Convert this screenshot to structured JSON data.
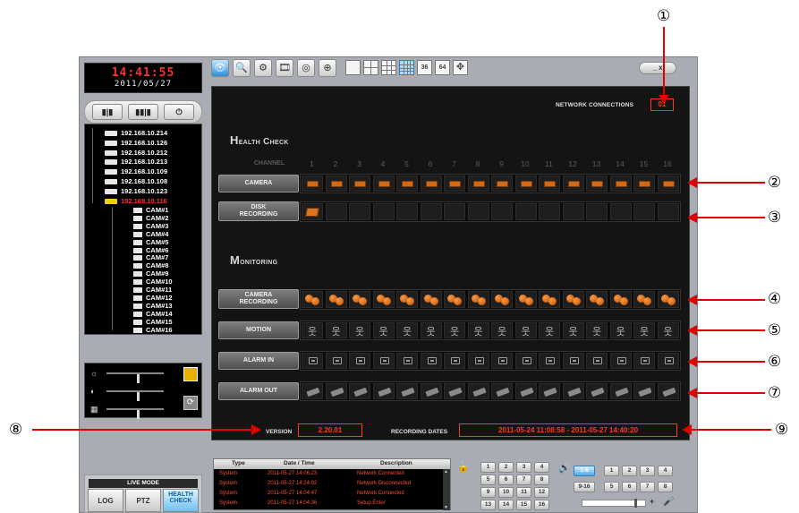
{
  "clock": {
    "time": "14:41:55",
    "date": "2011/05/27"
  },
  "split_buttons": [
    "▮|▮",
    "▮▮|▮",
    "⏻"
  ],
  "tree": {
    "devices": [
      "192.168.10.214",
      "192.168.10.126",
      "192.168.10.212",
      "192.168.10.213",
      "192.168.10.109",
      "192.168.10.108",
      "192.168.10.123",
      "192.168.10.116"
    ],
    "cameras": [
      "CAM#1",
      "CAM#2",
      "CAM#3",
      "CAM#4",
      "CAM#5",
      "CAM#6",
      "CAM#7",
      "CAM#8",
      "CAM#9",
      "CAM#10",
      "CAM#11",
      "CAM#12",
      "CAM#13",
      "CAM#14",
      "CAM#15",
      "CAM#16"
    ]
  },
  "adjust": {
    "icons": [
      "☼",
      "◐",
      "▦"
    ],
    "reset_icon": "⟳"
  },
  "mode": {
    "label": "LIVE MODE",
    "log": "LOG",
    "ptz": "PTZ",
    "health": "HEALTH CHECK"
  },
  "toolbar": {
    "tools": [
      "👁",
      "🔍",
      "⚙",
      "🎞",
      "◎",
      "⊕"
    ],
    "layouts": [
      "1",
      "4",
      "9",
      "16",
      "36",
      "64"
    ],
    "win_ctrl": "_  x"
  },
  "health": {
    "network_label": "NETWORK CONNECTIONS",
    "network_value": "01",
    "health_title": "Health Check",
    "monitoring_title": "Monitoring",
    "channel_label": "CHANNEL",
    "channels": [
      "1",
      "2",
      "3",
      "4",
      "5",
      "6",
      "7",
      "8",
      "9",
      "10",
      "11",
      "12",
      "13",
      "14",
      "15",
      "16"
    ],
    "row_camera": "CAMERA",
    "row_disk_1": "DISK",
    "row_disk_2": "RECORDING",
    "row_camrec_1": "CAMERA",
    "row_camrec_2": "RECORDING",
    "row_motion": "MOTION",
    "row_alarm_in": "ALARM IN",
    "row_alarm_out": "ALARM OUT",
    "motion_glyph": "웃",
    "version_label": "VERSION",
    "version_value": "2.20.01",
    "recdates_label": "RECORDING DATES",
    "recdates_value": "2011-05-24 11:08:58  -  2011-05-27 14:40:20"
  },
  "log": {
    "headers": {
      "type": "Type",
      "datetime": "Date / Time",
      "description": "Description"
    },
    "rows": [
      {
        "type": "System",
        "datetime": "2011-05-27 14:06:23",
        "description": "Network Connected"
      },
      {
        "type": "System",
        "datetime": "2011-05-27 14:24:02",
        "description": "Network Disconnected"
      },
      {
        "type": "System",
        "datetime": "2011-05-27 14:04:47",
        "description": "Network Connected"
      },
      {
        "type": "System",
        "datetime": "2011-05-27 14:04:36",
        "description": "Setup Enter"
      }
    ]
  },
  "channel_grid": [
    "1",
    "2",
    "3",
    "4",
    "5",
    "6",
    "7",
    "8",
    "9",
    "10",
    "11",
    "12",
    "13",
    "14",
    "15",
    "16"
  ],
  "group_buttons": [
    "1-8",
    "9-16"
  ],
  "right_grid": [
    "1",
    "2",
    "3",
    "4",
    "5",
    "6",
    "7",
    "8"
  ],
  "bottom_icons": {
    "lock": "🔒",
    "speaker": "🔊",
    "plus": "+",
    "mic": "🎤"
  },
  "callouts": [
    "①",
    "②",
    "③",
    "④",
    "⑤",
    "⑥",
    "⑦",
    "⑧",
    "⑨"
  ],
  "colors": {
    "accent_red": "#ff3a1a",
    "icon_orange": "#d06a18",
    "highlight_blue": "#4ea8e6"
  }
}
